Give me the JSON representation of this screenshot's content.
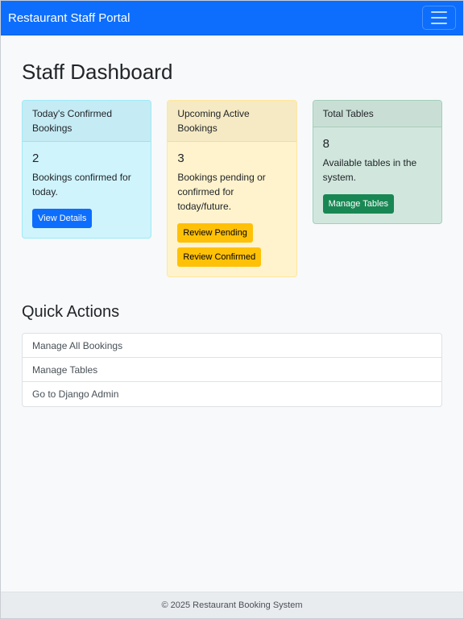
{
  "navbar": {
    "brand": "Restaurant Staff Portal"
  },
  "page": {
    "title": "Staff Dashboard"
  },
  "cards": [
    {
      "header": "Today's Confirmed Bookings",
      "count": "2",
      "text": "Bookings confirmed for today.",
      "buttons": [
        "View Details"
      ],
      "color": "#cff4fc"
    },
    {
      "header": "Upcoming Active Bookings",
      "count": "3",
      "text": "Bookings pending or confirmed for today/future.",
      "buttons": [
        "Review Pending",
        "Review Confirmed"
      ],
      "color": "#fff3cd"
    },
    {
      "header": "Total Tables",
      "count": "8",
      "text": "Available tables in the system.",
      "buttons": [
        "Manage Tables"
      ],
      "color": "#d1e7dd"
    }
  ],
  "quick_actions": {
    "title": "Quick Actions",
    "items": [
      "Manage All Bookings",
      "Manage Tables",
      "Go to Django Admin"
    ]
  },
  "footer": {
    "text": "© 2025 Restaurant Booking System"
  },
  "colors": {
    "primary": "#0d6efd",
    "warning": "#ffc107",
    "success": "#198754"
  }
}
